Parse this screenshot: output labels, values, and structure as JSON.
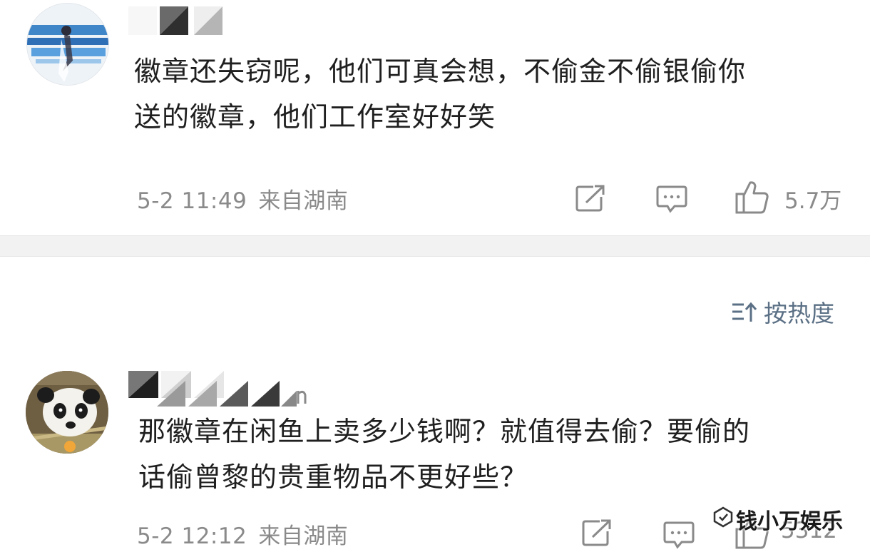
{
  "comments": [
    {
      "content_line1": "徽章还失窃呢，他们可真会想，不偷金不偷银偷你",
      "content_line2": "送的徽章，他们工作室好好笑",
      "date": "5-2 11:49",
      "location": "来自湖南",
      "likes": "5.7万"
    },
    {
      "content_line1": "那徽章在闲鱼上卖多少钱啊？就值得去偷？要偷的",
      "content_line2": "话偷曾黎的贵重物品不更好些？",
      "date": "5-2 12:12",
      "location": "来自湖南",
      "likes": "5312"
    }
  ],
  "sort": {
    "label": "按热度",
    "icon": "sort-icon"
  },
  "icons": {
    "forward": "forward-icon",
    "reply": "reply-icon",
    "like": "thumbs-up-icon"
  },
  "watermark": {
    "text": "钱小万娱乐"
  },
  "colors": {
    "text": "#1f1f1f",
    "meta": "#8a8a8a",
    "sort": "#5b7085",
    "divider": "#f2f2f2"
  }
}
